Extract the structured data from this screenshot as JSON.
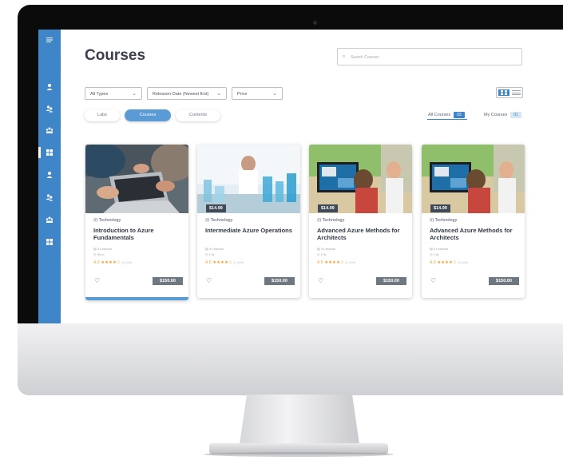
{
  "header": {
    "page_title": "Courses",
    "search_placeholder": "Search Courses"
  },
  "filters": {
    "type": "All Types",
    "sort": "Releasen Date (Newest first)",
    "price": "Price"
  },
  "tabs": [
    {
      "label": "Labs",
      "active": false
    },
    {
      "label": "Courses",
      "active": true
    },
    {
      "label": "Contents",
      "active": false
    }
  ],
  "counters": {
    "all_label": "All Courses",
    "all_count": "03",
    "my_label": "My Courses",
    "my_count": "01"
  },
  "sidebar": {
    "icons": [
      "menu-icon",
      "user-icon",
      "users-icon",
      "group-icon",
      "dashboard-icon",
      "user-icon",
      "users-icon",
      "group-icon",
      "dashboard-icon"
    ]
  },
  "cards": [
    {
      "category": "Technology",
      "title": "Introduction to Azure Fundamentals",
      "price_tag": "",
      "lessons": "3 Lessons",
      "duration": "45 m",
      "rating": "4.0",
      "stars": "★★★★☆",
      "reviews": "(1,099)",
      "price": "$150.00"
    },
    {
      "category": "Technology",
      "title": "Intermediate Azure Operations",
      "price_tag": "$14.99",
      "lessons": "3 Lessons",
      "duration": "1 hr",
      "rating": "4.0",
      "stars": "★★★★☆",
      "reviews": "(1,099)",
      "price": "$150.00"
    },
    {
      "category": "Technology",
      "title": "Advanced Azure Methods for Architects",
      "price_tag": "$14.99",
      "lessons": "3 Lessons",
      "duration": "1 hr",
      "rating": "4.0",
      "stars": "★★★★☆",
      "reviews": "(1,099)",
      "price": "$150.00"
    },
    {
      "category": "Technology",
      "title": "Advanced Azure Methods for Architects",
      "price_tag": "$14.99",
      "lessons": "3 Lessons",
      "duration": "1 hr",
      "rating": "4.0",
      "stars": "★★★★☆",
      "reviews": "(1,099)",
      "price": "$150.00"
    }
  ],
  "colors": {
    "accent": "#3e86c8",
    "star": "#e8a33c",
    "price_button": "#6f7780"
  }
}
